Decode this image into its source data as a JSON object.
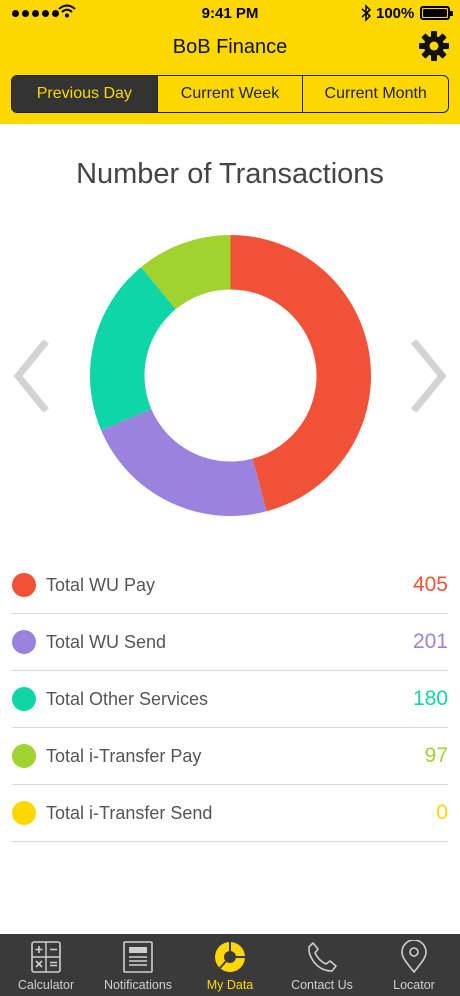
{
  "status_bar": {
    "time": "9:41 PM",
    "battery": "100%"
  },
  "header": {
    "title": "BoB Finance"
  },
  "segments": [
    {
      "label": "Previous Day",
      "active": true
    },
    {
      "label": "Current Week",
      "active": false
    },
    {
      "label": "Current Month",
      "active": false
    }
  ],
  "chart_data": {
    "type": "donut",
    "title": "Number of Transactions",
    "series": [
      {
        "name": "Total WU Pay",
        "value": 405,
        "color": "#f15237"
      },
      {
        "name": "Total WU Send",
        "value": 201,
        "color": "#9b82de"
      },
      {
        "name": "Total Other Services",
        "value": 180,
        "color": "#0fd6a6"
      },
      {
        "name": "Total i-Transfer Pay",
        "value": 97,
        "color": "#a0d330"
      },
      {
        "name": "Total i-Transfer Send",
        "value": 0,
        "color": "#fdd800"
      }
    ]
  },
  "tabs": [
    {
      "label": "Calculator",
      "icon": "calculator-icon",
      "active": false
    },
    {
      "label": "Notifications",
      "icon": "notifications-icon",
      "active": false
    },
    {
      "label": "My Data",
      "icon": "my-data-icon",
      "active": true
    },
    {
      "label": "Contact Us",
      "icon": "phone-icon",
      "active": false
    },
    {
      "label": "Locator",
      "icon": "map-pin-icon",
      "active": false
    }
  ]
}
